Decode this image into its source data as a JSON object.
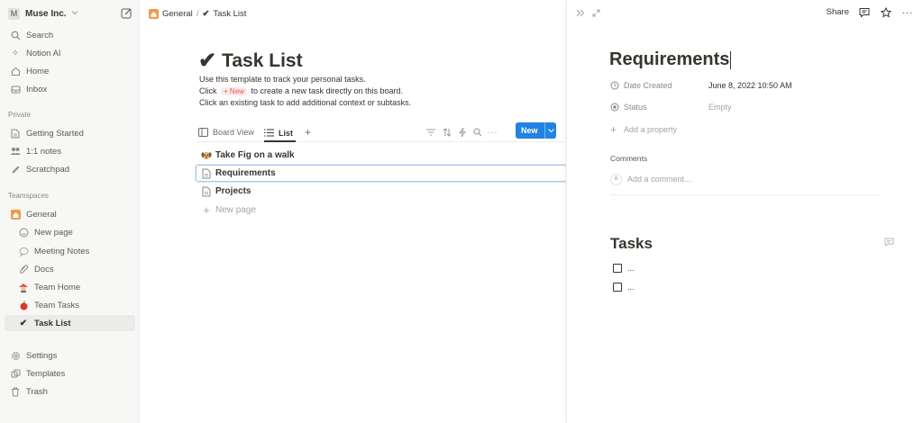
{
  "workspace": {
    "badge": "M",
    "name": "Muse Inc."
  },
  "sidebar": {
    "top_items": [
      {
        "label": "Search",
        "icon": "search-icon"
      },
      {
        "label": "Notion AI",
        "icon": "sparkle-icon"
      },
      {
        "label": "Home",
        "icon": "home-icon"
      },
      {
        "label": "Inbox",
        "icon": "inbox-icon"
      }
    ],
    "private_header": "Private",
    "private_items": [
      {
        "label": "Getting Started",
        "icon": "page-icon"
      },
      {
        "label": "1:1 notes",
        "icon": "people-icon"
      },
      {
        "label": "Scratchpad",
        "icon": "pencil-icon"
      }
    ],
    "teamspaces_header": "Teamspaces",
    "teamspace": {
      "label": "General",
      "icon": "house-emoji-icon"
    },
    "teamspace_items": [
      {
        "label": "New page",
        "icon": "smiley-icon"
      },
      {
        "label": "Meeting Notes",
        "icon": "speech-bubble-icon"
      },
      {
        "label": "Docs",
        "icon": "paperclip-icon"
      },
      {
        "label": "Team Home",
        "icon": "team-emoji-icon"
      },
      {
        "label": "Team Tasks",
        "icon": "red-apple-icon"
      },
      {
        "label": "Task List",
        "icon": "checkmark-icon"
      }
    ],
    "bottom_items": [
      {
        "label": "Settings",
        "icon": "gear-icon"
      },
      {
        "label": "Templates",
        "icon": "templates-icon"
      },
      {
        "label": "Trash",
        "icon": "trash-icon"
      }
    ]
  },
  "breadcrumb": {
    "parent": "General",
    "separator": "/",
    "current": "Task List"
  },
  "page": {
    "title": "Task List",
    "desc1": "Use this template to track your personal tasks.",
    "desc2_pre": "Click",
    "desc2_pill": "+ New",
    "desc2_post": "to create a new task directly on this board.",
    "desc3": "Click an existing task to add additional context or subtasks."
  },
  "views": {
    "tabs": [
      {
        "label": "Board View"
      },
      {
        "label": "List"
      }
    ],
    "add": "+",
    "new_button": "New"
  },
  "rows": [
    {
      "label": "Take Fig on a walk",
      "icon": "dog-emoji-icon"
    },
    {
      "label": "Requirements",
      "icon": "page-icon"
    },
    {
      "label": "Projects",
      "icon": "page-icon"
    }
  ],
  "new_page": "New page",
  "peek": {
    "share": "Share",
    "title": "Requirements",
    "properties": [
      {
        "name": "Date Created",
        "value": "June 8, 2022 10:50 AM"
      },
      {
        "name": "Status",
        "value": "Empty"
      }
    ],
    "add_property": "Add a property",
    "comments_label": "Comments",
    "avatar": "A",
    "comment_placeholder": "Add a comment...",
    "tasks_heading": "Tasks",
    "todos": [
      "...",
      "..."
    ]
  }
}
